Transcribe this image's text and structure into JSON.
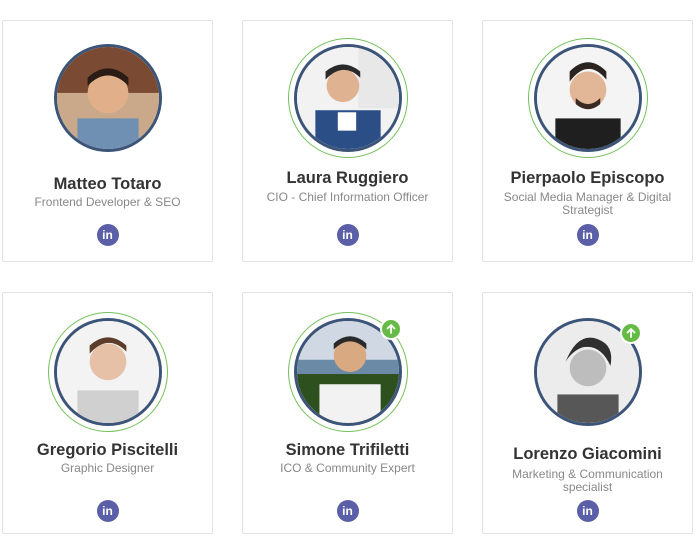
{
  "team": [
    {
      "name": "Matteo Totaro",
      "role": "Frontend Developer & SEO",
      "linkedin": "in",
      "ring_color": "#74c05a",
      "border_color": "#3b5478",
      "online_badge": false
    },
    {
      "name": "Laura Ruggiero",
      "role": "CIO - Chief Information Officer",
      "linkedin": "in",
      "ring_color": "#74c05a",
      "border_color": "#3b5478",
      "online_badge": false
    },
    {
      "name": "Pierpaolo Episcopo",
      "role": "Social Media Manager & Digital Strategist",
      "linkedin": "in",
      "ring_color": "#74c05a",
      "border_color": "#3b5478",
      "online_badge": false
    },
    {
      "name": "Gregorio Piscitelli",
      "role": "Graphic Designer",
      "linkedin": "in",
      "ring_color": "#74c05a",
      "border_color": "#3b5478",
      "online_badge": false
    },
    {
      "name": "Simone Trifiletti",
      "role": "ICO & Community Expert",
      "linkedin": "in",
      "ring_color": "#74c05a",
      "border_color": "#3b5478",
      "online_badge": true
    },
    {
      "name": "Lorenzo Giacomini",
      "role": "Marketing & Communication specialist",
      "linkedin": "in",
      "ring_color": "#74c05a",
      "border_color": "#3b5478",
      "online_badge": true
    }
  ]
}
